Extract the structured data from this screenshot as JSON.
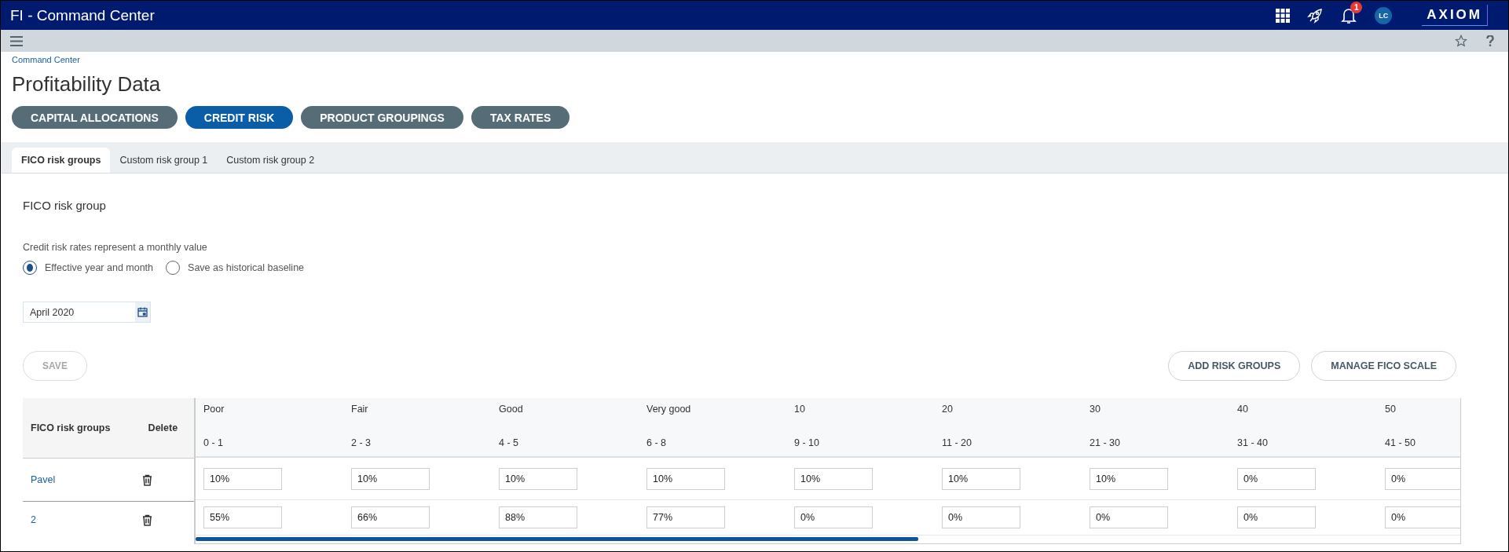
{
  "app_bar": {
    "title": "FI - Command Center",
    "notification_count": "1",
    "avatar": "LC",
    "logo": "AXIOM"
  },
  "breadcrumb": "Command Center",
  "page_title": "Profitability Data",
  "sections": [
    {
      "label": "CAPITAL ALLOCATIONS",
      "selected": false
    },
    {
      "label": "CREDIT RISK",
      "selected": true
    },
    {
      "label": "PRODUCT GROUPINGS",
      "selected": false
    },
    {
      "label": "TAX RATES",
      "selected": false
    }
  ],
  "tabs": [
    {
      "label": "FICO risk groups",
      "selected": true
    },
    {
      "label": "Custom risk group 1",
      "selected": false
    },
    {
      "label": "Custom risk group 2",
      "selected": false
    }
  ],
  "panel_title": "FICO risk group",
  "note": "Credit risk rates represent a monthly value",
  "radios": [
    {
      "label": "Effective year and month",
      "selected": true
    },
    {
      "label": "Save as historical baseline",
      "selected": false
    }
  ],
  "date_field": {
    "value": "April 2020"
  },
  "save_button": {
    "label": "SAVE",
    "disabled": true
  },
  "actions": [
    "ADD RISK GROUPS",
    "MANAGE FICO SCALE"
  ],
  "table": {
    "fixed_columns": [
      "FICO risk groups",
      "Delete"
    ],
    "columns": [
      {
        "name": "Poor",
        "range": "0 - 1"
      },
      {
        "name": "Fair",
        "range": "2 - 3"
      },
      {
        "name": "Good",
        "range": "4 - 5"
      },
      {
        "name": "Very good",
        "range": "6 - 8"
      },
      {
        "name": "10",
        "range": "9 - 10"
      },
      {
        "name": "20",
        "range": "11 - 20"
      },
      {
        "name": "30",
        "range": "21 - 30"
      },
      {
        "name": "40",
        "range": "31 - 40"
      },
      {
        "name": "50",
        "range": "41 - 50"
      }
    ],
    "rows": [
      {
        "group": "Pavel",
        "values": [
          "10%",
          "10%",
          "10%",
          "10%",
          "10%",
          "10%",
          "10%",
          "0%",
          "0%"
        ]
      },
      {
        "group": "2",
        "values": [
          "55%",
          "66%",
          "88%",
          "77%",
          "0%",
          "0%",
          "0%",
          "0%",
          "0%"
        ]
      }
    ]
  }
}
